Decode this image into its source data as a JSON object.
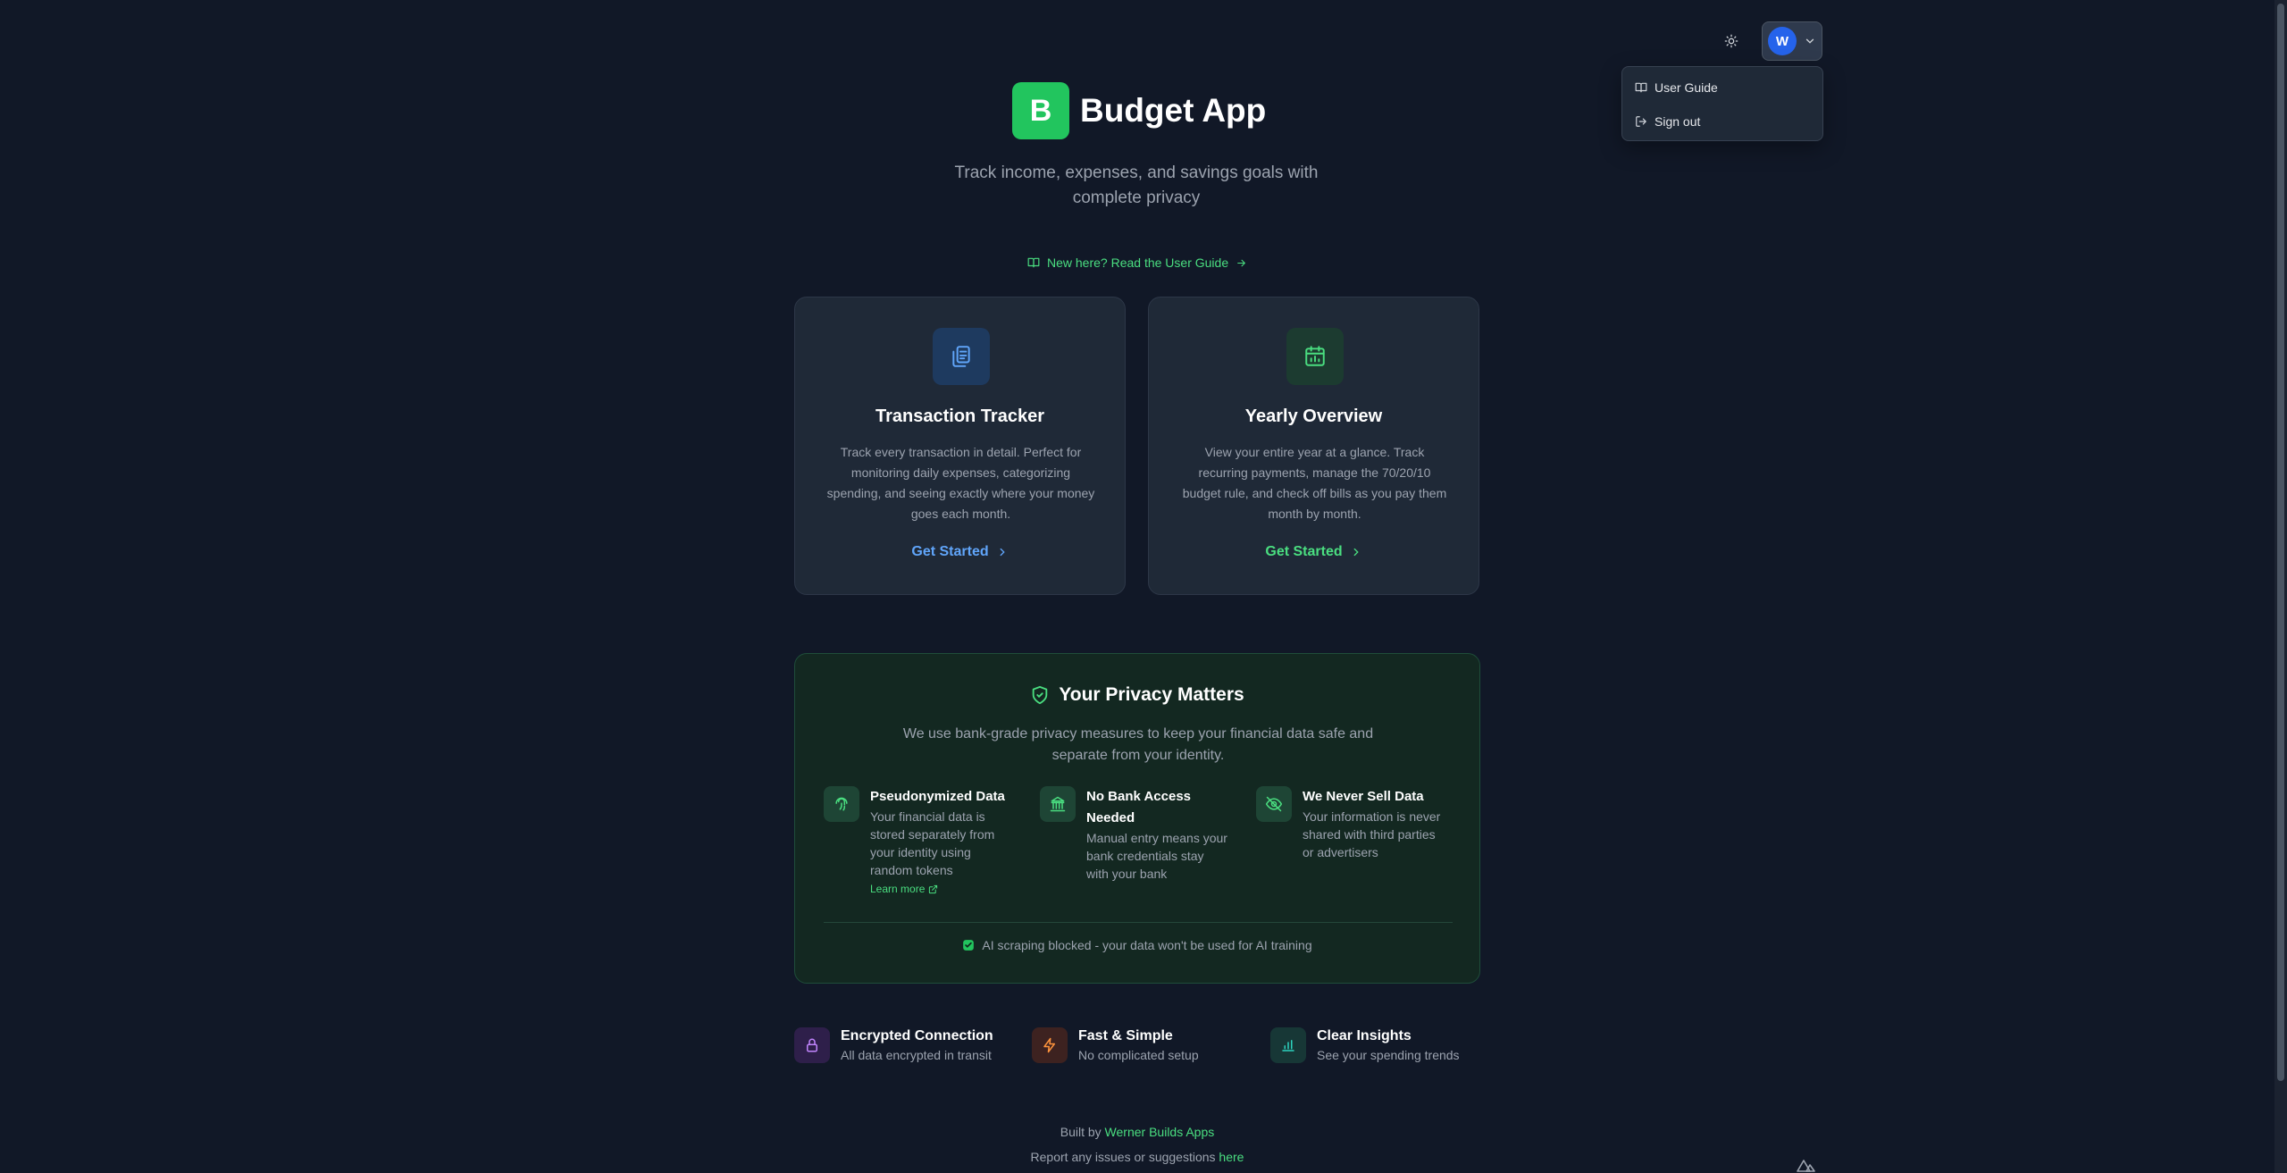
{
  "header": {
    "logo_letter": "B",
    "app_title": "Budget App",
    "subtitle": "Track income, expenses, and savings goals with complete privacy",
    "guide_link": "New here? Read the User Guide"
  },
  "topbar": {
    "theme_icon": "sun-icon",
    "avatar_initial": "W"
  },
  "user_menu": {
    "items": [
      {
        "label": "User Guide",
        "icon": "book-icon"
      },
      {
        "label": "Sign out",
        "icon": "sign-out-icon"
      }
    ]
  },
  "cards": [
    {
      "title": "Transaction Tracker",
      "description": "Track every transaction in detail. Perfect for monitoring daily expenses, categorizing spending, and seeing exactly where your money goes each month.",
      "cta": "Get Started",
      "icon": "clipboard-icon",
      "accent": "#60a5fa"
    },
    {
      "title": "Yearly Overview",
      "description": "View your entire year at a glance. Track recurring payments, manage the 70/20/10 budget rule, and check off bills as you pay them month by month.",
      "cta": "Get Started",
      "icon": "calendar-icon",
      "accent": "#4ade80"
    }
  ],
  "privacy": {
    "title": "Your Privacy Matters",
    "description": "We use bank-grade privacy measures to keep your financial data safe and separate from your identity.",
    "features": [
      {
        "title": "Pseudonymized Data",
        "description": "Your financial data is stored separately from your identity using random tokens",
        "link": "Learn more",
        "icon": "fingerprint-icon"
      },
      {
        "title": "No Bank Access Needed",
        "description": "Manual entry means your bank credentials stay with your bank",
        "icon": "bank-icon"
      },
      {
        "title": "We Never Sell Data",
        "description": "Your information is never shared with third parties or advertisers",
        "icon": "eye-off-icon"
      }
    ],
    "ai_note": "AI scraping blocked - your data won't be used for AI training"
  },
  "bottom_features": [
    {
      "title": "Encrypted Connection",
      "description": "All data encrypted in transit",
      "icon": "lock-icon"
    },
    {
      "title": "Fast & Simple",
      "description": "No complicated setup",
      "icon": "lightning-icon"
    },
    {
      "title": "Clear Insights",
      "description": "See your spending trends",
      "icon": "bar-chart-icon"
    }
  ],
  "footer": {
    "built_by_prefix": "Built by ",
    "built_by_link": "Werner Builds Apps",
    "report_prefix": "Report any issues or suggestions ",
    "report_link": "here"
  },
  "colors": {
    "background": "#111827",
    "brand_green": "#22c55e",
    "link_green": "#4ade80",
    "blue_accent": "#60a5fa"
  }
}
